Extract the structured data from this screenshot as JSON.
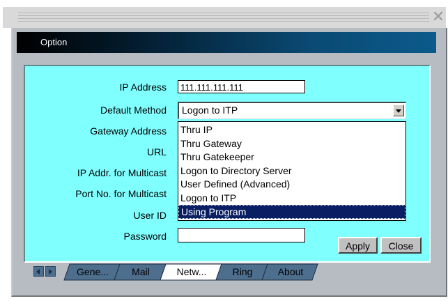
{
  "window": {
    "close_glyph": "✕"
  },
  "header": {
    "title": "Option"
  },
  "form": {
    "labels": {
      "ip_address": "IP Address",
      "default_method": "Default Method",
      "gateway_address": "Gateway Address",
      "url": "URL",
      "ip_multicast": "IP Addr. for Multicast",
      "port_multicast": "Port No. for Multicast",
      "user_id": "User ID",
      "password": "Password"
    },
    "ip_address_value": "111.111.111.111",
    "password_value": ""
  },
  "combo": {
    "selected": "Logon to ITP",
    "options": [
      "Thru IP",
      "Thru Gateway",
      "Thru Gatekeeper",
      "Logon to Directory Server",
      "User Defined (Advanced)",
      "Logon to ITP",
      "Using Program"
    ],
    "highlighted_index": 6
  },
  "buttons": {
    "apply": "Apply",
    "close": "Close"
  },
  "tabs": [
    "Gene...",
    "Mail",
    "Netw...",
    "Ring",
    "About"
  ],
  "active_tab_index": 2,
  "colors": {
    "panel": "#80ffff",
    "selection": "#0a1e63",
    "tab_bg": "#4e6e8e"
  }
}
